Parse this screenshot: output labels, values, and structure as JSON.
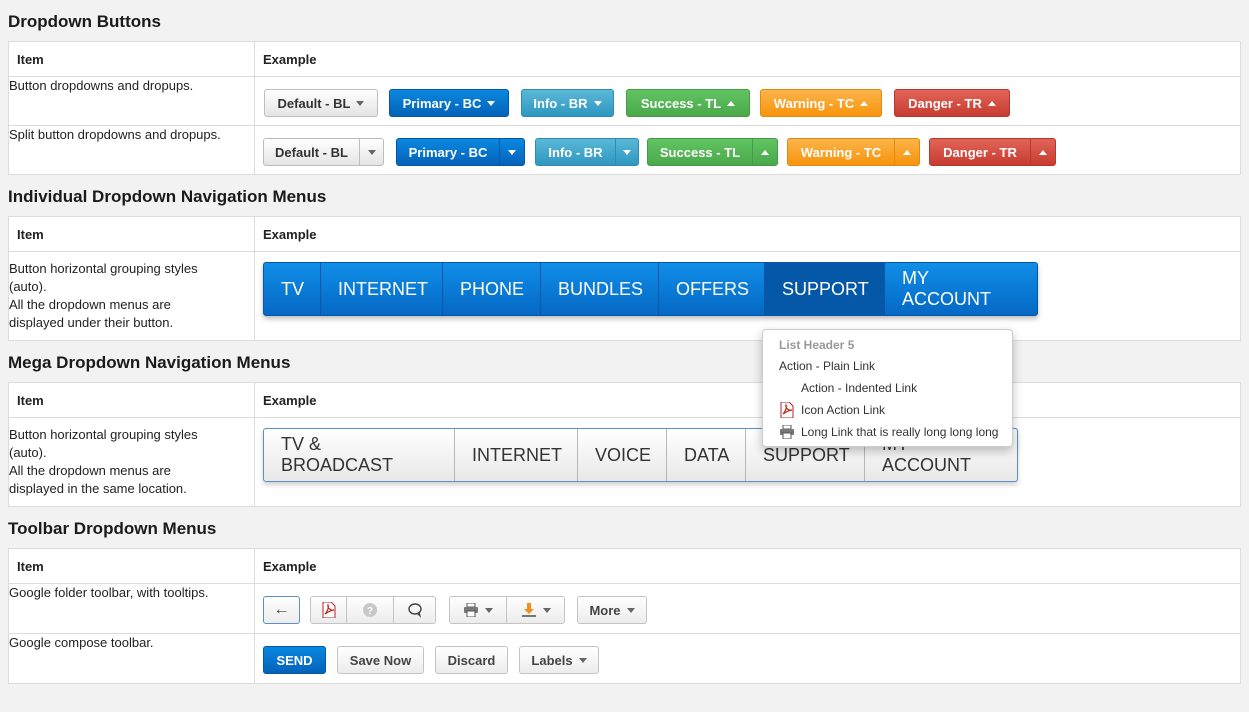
{
  "sections": {
    "dropdown_buttons": {
      "title": "Dropdown Buttons",
      "col_item": "Item",
      "col_example": "Example",
      "row1_desc": "Button dropdowns and dropups.",
      "row2_desc": "Split button dropdowns and dropups.",
      "buttons": [
        "Default - BL",
        "Primary - BC",
        "Info - BR",
        "Success - TL",
        "Warning - TC",
        "Danger - TR"
      ]
    },
    "individual_nav": {
      "title": "Individual Dropdown Navigation Menus",
      "col_item": "Item",
      "col_example": "Example",
      "desc_line1": "Button horizontal grouping styles",
      "desc_line2": "(auto).",
      "desc_line3": "All the dropdown menus are",
      "desc_line4": "displayed under their button.",
      "nav_items": [
        "TV",
        "INTERNET",
        "PHONE",
        "BUNDLES",
        "OFFERS",
        "SUPPORT",
        "MY ACCOUNT"
      ],
      "active_item": "SUPPORT"
    },
    "dropdown_menu": {
      "header": "List Header 5",
      "items": {
        "plain": "Action - Plain Link",
        "indented": "Action - Indented Link",
        "icon": "Icon Action Link",
        "long": "Long Link that is really long long long"
      }
    },
    "mega_nav": {
      "title": "Mega Dropdown Navigation Menus",
      "col_item": "Item",
      "col_example": "Example",
      "desc_line1": "Button horizontal grouping styles",
      "desc_line2": "(auto).",
      "desc_line3": "All the dropdown menus are",
      "desc_line4": "displayed in the same location.",
      "nav_items": [
        "TV & BROADCAST",
        "INTERNET",
        "VOICE",
        "DATA",
        "SUPPORT",
        "MY ACCOUNT"
      ]
    },
    "toolbar": {
      "title": "Toolbar Dropdown Menus",
      "col_item": "Item",
      "col_example": "Example",
      "row1_desc": "Google folder toolbar, with tooltips.",
      "row2_desc": "Google compose toolbar.",
      "back_label": "←",
      "more_label": "More",
      "send_label": "SEND",
      "save_label": "Save Now",
      "discard_label": "Discard",
      "labels_label": "Labels"
    }
  },
  "colors": {
    "primary": "#0568c4",
    "info": "#2f97c0",
    "success": "#4aa84a",
    "warning": "#f8940c",
    "danger": "#c83c30"
  }
}
